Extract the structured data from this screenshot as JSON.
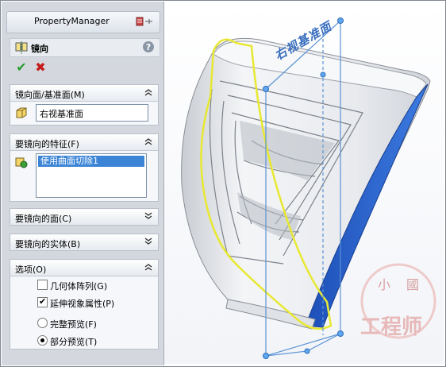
{
  "property_manager": {
    "title": "PropertyManager"
  },
  "feature": {
    "title": "镜向",
    "help": "?"
  },
  "actions": {
    "ok": "✔",
    "cancel": "✖"
  },
  "groups": {
    "mirror_face": {
      "title": "镜向面/基准面(M)",
      "value": "右视基准面"
    },
    "features": {
      "title": "要镜向的特征(F)",
      "items": [
        "使用曲面切除1"
      ]
    },
    "faces": {
      "title": "要镜向的面(C)"
    },
    "bodies": {
      "title": "要镜向的实体(B)"
    },
    "options": {
      "title": "选项(O)",
      "geometry_pattern": "几何体阵列(G)",
      "propagate_visual": "延伸视象属性(P)",
      "full_preview": "完整预览(F)",
      "partial_preview": "部分预览(T)"
    }
  },
  "viewport": {
    "plane_label": "右视基准面",
    "watermark_chars": [
      "小",
      "國"
    ],
    "watermark_text": "工程师"
  },
  "colors": {
    "accent": "#2f67d6",
    "selection": "#3b84d6",
    "highlight": "#e8e832",
    "plane": "#3a6fbf"
  }
}
